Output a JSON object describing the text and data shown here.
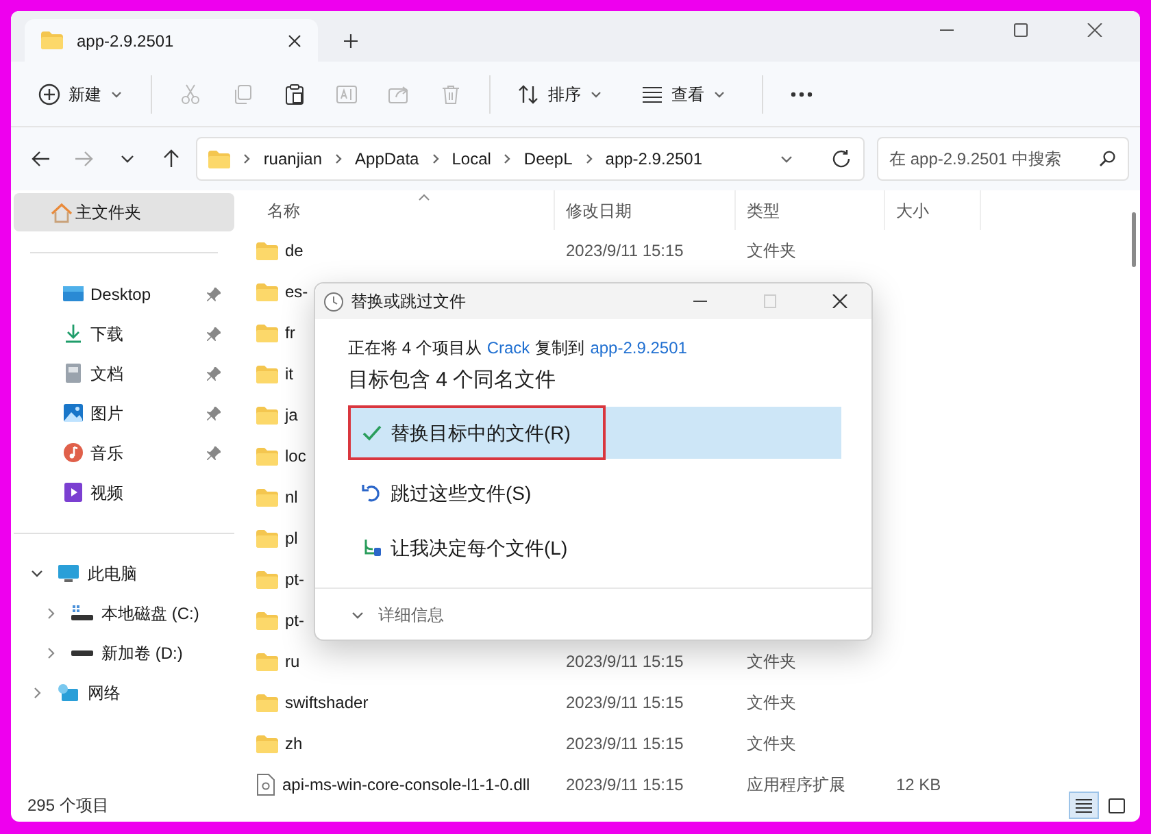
{
  "window": {
    "tab_title": "app-2.9.2501"
  },
  "toolbar": [
    {
      "kind": "new",
      "label": "新建",
      "disabled": false
    },
    {
      "kind": "cut",
      "disabled": true
    },
    {
      "kind": "copy",
      "disabled": true
    },
    {
      "kind": "paste",
      "disabled": false
    },
    {
      "kind": "rename",
      "disabled": true
    },
    {
      "kind": "share",
      "disabled": true
    },
    {
      "kind": "delete",
      "disabled": true
    },
    {
      "kind": "sort",
      "label": "排序",
      "disabled": false
    },
    {
      "kind": "view",
      "label": "查看",
      "disabled": false
    },
    {
      "kind": "more",
      "disabled": false
    }
  ],
  "address": {
    "segments": [
      "ruanjian",
      "AppData",
      "Local",
      "DeepL",
      "app-2.9.2501"
    ],
    "search_placeholder": "在 app-2.9.2501 中搜索"
  },
  "sidebar": {
    "home": {
      "label": "主文件夹",
      "selected": true
    },
    "quick_access": [
      {
        "kind": "desktop",
        "label": "Desktop",
        "pinned": true
      },
      {
        "kind": "download",
        "label": "下载",
        "pinned": true
      },
      {
        "kind": "document",
        "label": "文档",
        "pinned": true
      },
      {
        "kind": "picture",
        "label": "图片",
        "pinned": true
      },
      {
        "kind": "music",
        "label": "音乐",
        "pinned": true
      },
      {
        "kind": "video",
        "label": "视频",
        "pinned": false
      }
    ],
    "tree": [
      {
        "kind": "pc",
        "label": "此电脑",
        "expanded": true,
        "children": [
          {
            "kind": "drive-c",
            "label": "本地磁盘 (C:)",
            "expanded": false
          },
          {
            "kind": "drive",
            "label": "新加卷 (D:)",
            "expanded": false
          }
        ]
      },
      {
        "kind": "network",
        "label": "网络",
        "expanded": false
      }
    ]
  },
  "table": {
    "columns": [
      "名称",
      "修改日期",
      "类型",
      "大小"
    ],
    "rows": [
      {
        "kind": "folder",
        "name": "de",
        "date": "2023/9/11 15:15",
        "type": "文件夹"
      },
      {
        "kind": "folder",
        "name": "es-"
      },
      {
        "kind": "folder",
        "name": "fr"
      },
      {
        "kind": "folder",
        "name": "it"
      },
      {
        "kind": "folder",
        "name": "ja"
      },
      {
        "kind": "folder",
        "name": "loc"
      },
      {
        "kind": "folder",
        "name": "nl"
      },
      {
        "kind": "folder",
        "name": "pl"
      },
      {
        "kind": "folder",
        "name": "pt-"
      },
      {
        "kind": "folder",
        "name": "pt-"
      },
      {
        "kind": "folder",
        "name": "ru",
        "date": "2023/9/11 15:15",
        "type": "文件夹"
      },
      {
        "kind": "folder",
        "name": "swiftshader",
        "date": "2023/9/11 15:15",
        "type": "文件夹"
      },
      {
        "kind": "folder",
        "name": "zh",
        "date": "2023/9/11 15:15",
        "type": "文件夹"
      },
      {
        "kind": "file",
        "name": "api-ms-win-core-console-l1-1-0.dll",
        "date": "2023/9/11 15:15",
        "type": "应用程序扩展",
        "size": "12 KB"
      }
    ]
  },
  "status_bar": {
    "count": "295 个项目",
    "views": [
      {
        "kind": "details",
        "selected": true
      },
      {
        "kind": "tiles",
        "selected": false
      }
    ]
  },
  "dialog": {
    "title": "替换或跳过文件",
    "message_start": "正在将 4 个项目从",
    "source": "Crack",
    "message_middle": "复制到",
    "destination": "app-2.9.2501",
    "heading": "目标包含 4 个同名文件",
    "options": [
      {
        "kind": "replace",
        "label": "替换目标中的文件(R)",
        "selected": true,
        "marked": true
      },
      {
        "kind": "skip",
        "label": "跳过这些文件(S)",
        "selected": false,
        "marked": false
      },
      {
        "kind": "decide",
        "label": "让我决定每个文件(L)",
        "selected": false,
        "marked": false
      }
    ],
    "details": "详细信息"
  }
}
